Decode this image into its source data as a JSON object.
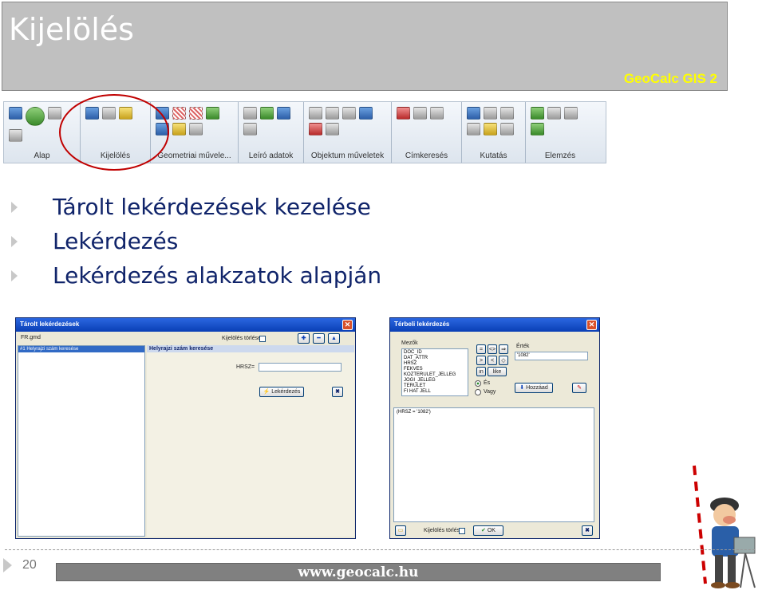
{
  "header": {
    "title": "Kijelölés",
    "brand": "GeoCalc GIS 2"
  },
  "ribbon": {
    "groups": [
      "Alap",
      "Kijelölés",
      "Geometriai művele...",
      "Leíró adatok",
      "Objektum műveletek",
      "Címkeresés",
      "Kutatás",
      "Elemzés"
    ]
  },
  "bullets": [
    "Tárolt lekérdezések kezelése",
    "Lekérdezés",
    "Lekérdezés alakzatok alapján"
  ],
  "dialog1": {
    "title": "Tárolt lekérdezések",
    "file": "FR.gmd",
    "delete_label": "Kijelölés törlése",
    "list_item": "#1 Helyrajzi szám keresése",
    "panel_title": "Helyrajzi szám keresése",
    "field_label": "HRSZ=",
    "query_button": "Lekérdezés"
  },
  "dialog2": {
    "title": "Térbeli lekérdezés",
    "fields_label": "Mezők",
    "fields": [
      "DOC_ID",
      "DAT_ATTR",
      "HRSZ",
      "FEKVES",
      "KOZTERULET_JELLEG",
      "JOGI_JELLEG",
      "TERULET",
      "FI HAT JELL"
    ],
    "values_label": "Érték",
    "value": "'1082'",
    "ops": [
      "=",
      "<>",
      ">",
      "<",
      "in",
      "like"
    ],
    "radio_and": "És",
    "radio_or": "Vagy",
    "add_button": "Hozzáad",
    "query_text": "(HRSZ = '1082')",
    "delete_label": "Kijelölés törlése",
    "ok_button": "OK"
  },
  "footer": {
    "page_number": "20",
    "url": "www.geocalc.hu"
  }
}
